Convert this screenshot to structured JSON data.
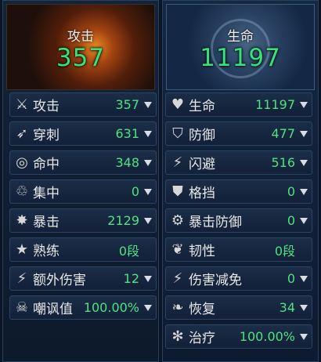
{
  "attack_panel": {
    "title": "攻击",
    "total": "357",
    "rows": [
      {
        "label": "攻击",
        "value": "357",
        "icon": "crossed-swords-icon"
      },
      {
        "label": "穿刺",
        "value": "631",
        "icon": "pierce-icon"
      },
      {
        "label": "命中",
        "value": "348",
        "icon": "target-icon"
      },
      {
        "label": "集中",
        "value": "0",
        "icon": "focus-icon"
      },
      {
        "label": "暴击",
        "value": "2129",
        "icon": "burst-icon"
      },
      {
        "label": "熟练",
        "value": "0段",
        "icon": "star-icon"
      },
      {
        "label": "额外伤害",
        "value": "12",
        "icon": "lightning-icon"
      },
      {
        "label": "嘲讽值",
        "value": "100.00%",
        "icon": "skull-icon"
      }
    ]
  },
  "life_panel": {
    "title": "生命",
    "total": "11197",
    "rows": [
      {
        "label": "生命",
        "value": "11197",
        "icon": "heart-icon"
      },
      {
        "label": "防御",
        "value": "477",
        "icon": "shield-icon"
      },
      {
        "label": "闪避",
        "value": "516",
        "icon": "dodge-icon"
      },
      {
        "label": "格挡",
        "value": "0",
        "icon": "block-icon"
      },
      {
        "label": "暴击防御",
        "value": "0",
        "icon": "crit-defense-icon"
      },
      {
        "label": "韧性",
        "value": "0段",
        "icon": "toughness-icon"
      },
      {
        "label": "伤害减免",
        "value": "0",
        "icon": "damage-reduction-icon"
      },
      {
        "label": "恢复",
        "value": "34",
        "icon": "sprout-icon"
      },
      {
        "label": "治疗",
        "value": "100.00%",
        "icon": "heal-icon"
      }
    ]
  },
  "colors": {
    "value_green": "#4fe27f",
    "title_green": "#37e27c",
    "label": "#e8e8e8"
  }
}
